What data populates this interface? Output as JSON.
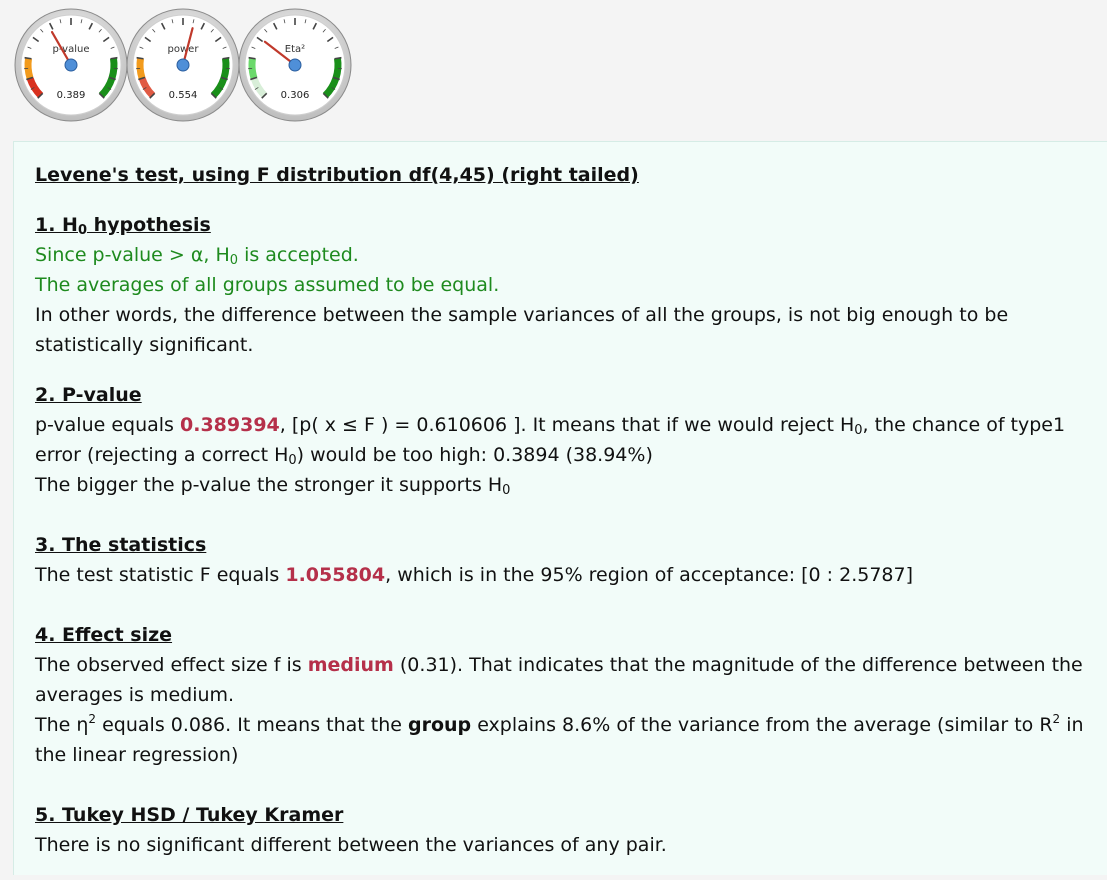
{
  "gauges": [
    {
      "label": "p-value",
      "value_text": "0.389",
      "value": 0.389,
      "colors": {
        "low": "#d9311f",
        "mid": "#f29b1d",
        "high": "#1a8f1a"
      }
    },
    {
      "label": "power",
      "value_text": "0.554",
      "value": 0.554,
      "colors": {
        "low": "#e05a44",
        "mid": "#f29b1d",
        "high": "#1a8f1a"
      }
    },
    {
      "label": "Eta²",
      "value_text": "0.306",
      "value": 0.306,
      "colors": {
        "low": "#d8eed8",
        "mid": "#6bd96b",
        "high": "#1a8f1a"
      }
    }
  ],
  "report": {
    "title": "Levene's test, using F distribution df(4,45) (right tailed)",
    "h0": {
      "heading": "1. H",
      "heading_sub": "0",
      "heading_tail": " hypothesis",
      "line1_a": "Since p-value > α, H",
      "line1_sub": "0",
      "line1_b": " is accepted.",
      "line2": "The averages of all groups assumed to be equal.",
      "line3": "In other words, the difference between the sample variances of all the groups, is not big enough to be statistically significant."
    },
    "pvalue": {
      "heading": "2. P-value",
      "a": "p-value equals ",
      "value": "0.389394",
      "b": ", [p( x ≤ F ) = 0.610606 ]. It means that if we would reject H",
      "b_sub": "0",
      "c": ", the chance of type1 error (rejecting a correct H",
      "c_sub": "0",
      "d": ") would be too high: 0.3894 (38.94%)",
      "line2": "The bigger the p-value the stronger it supports H",
      "line2_sub": "0"
    },
    "statistics": {
      "heading": "3. The statistics",
      "a": "The test statistic F equals ",
      "value": "1.055804",
      "b": ", which is in the 95% region of acceptance: [0 : 2.5787]"
    },
    "effect": {
      "heading": "4. Effect size",
      "a": "The observed effect size f is ",
      "value": "medium",
      "b": " (0.31). That indicates that the magnitude of the difference between the averages is medium.",
      "c": "The η",
      "c_sup": "2",
      "d": " equals 0.086. It means that the ",
      "group": "group",
      "e": " explains 8.6% of the variance from the average (similar to R",
      "e_sup": "2",
      "f": " in the linear regression)"
    },
    "tukey": {
      "heading": "5. Tukey HSD / Tukey Kramer",
      "line": "There is no significant different between the variances of any pair."
    }
  }
}
